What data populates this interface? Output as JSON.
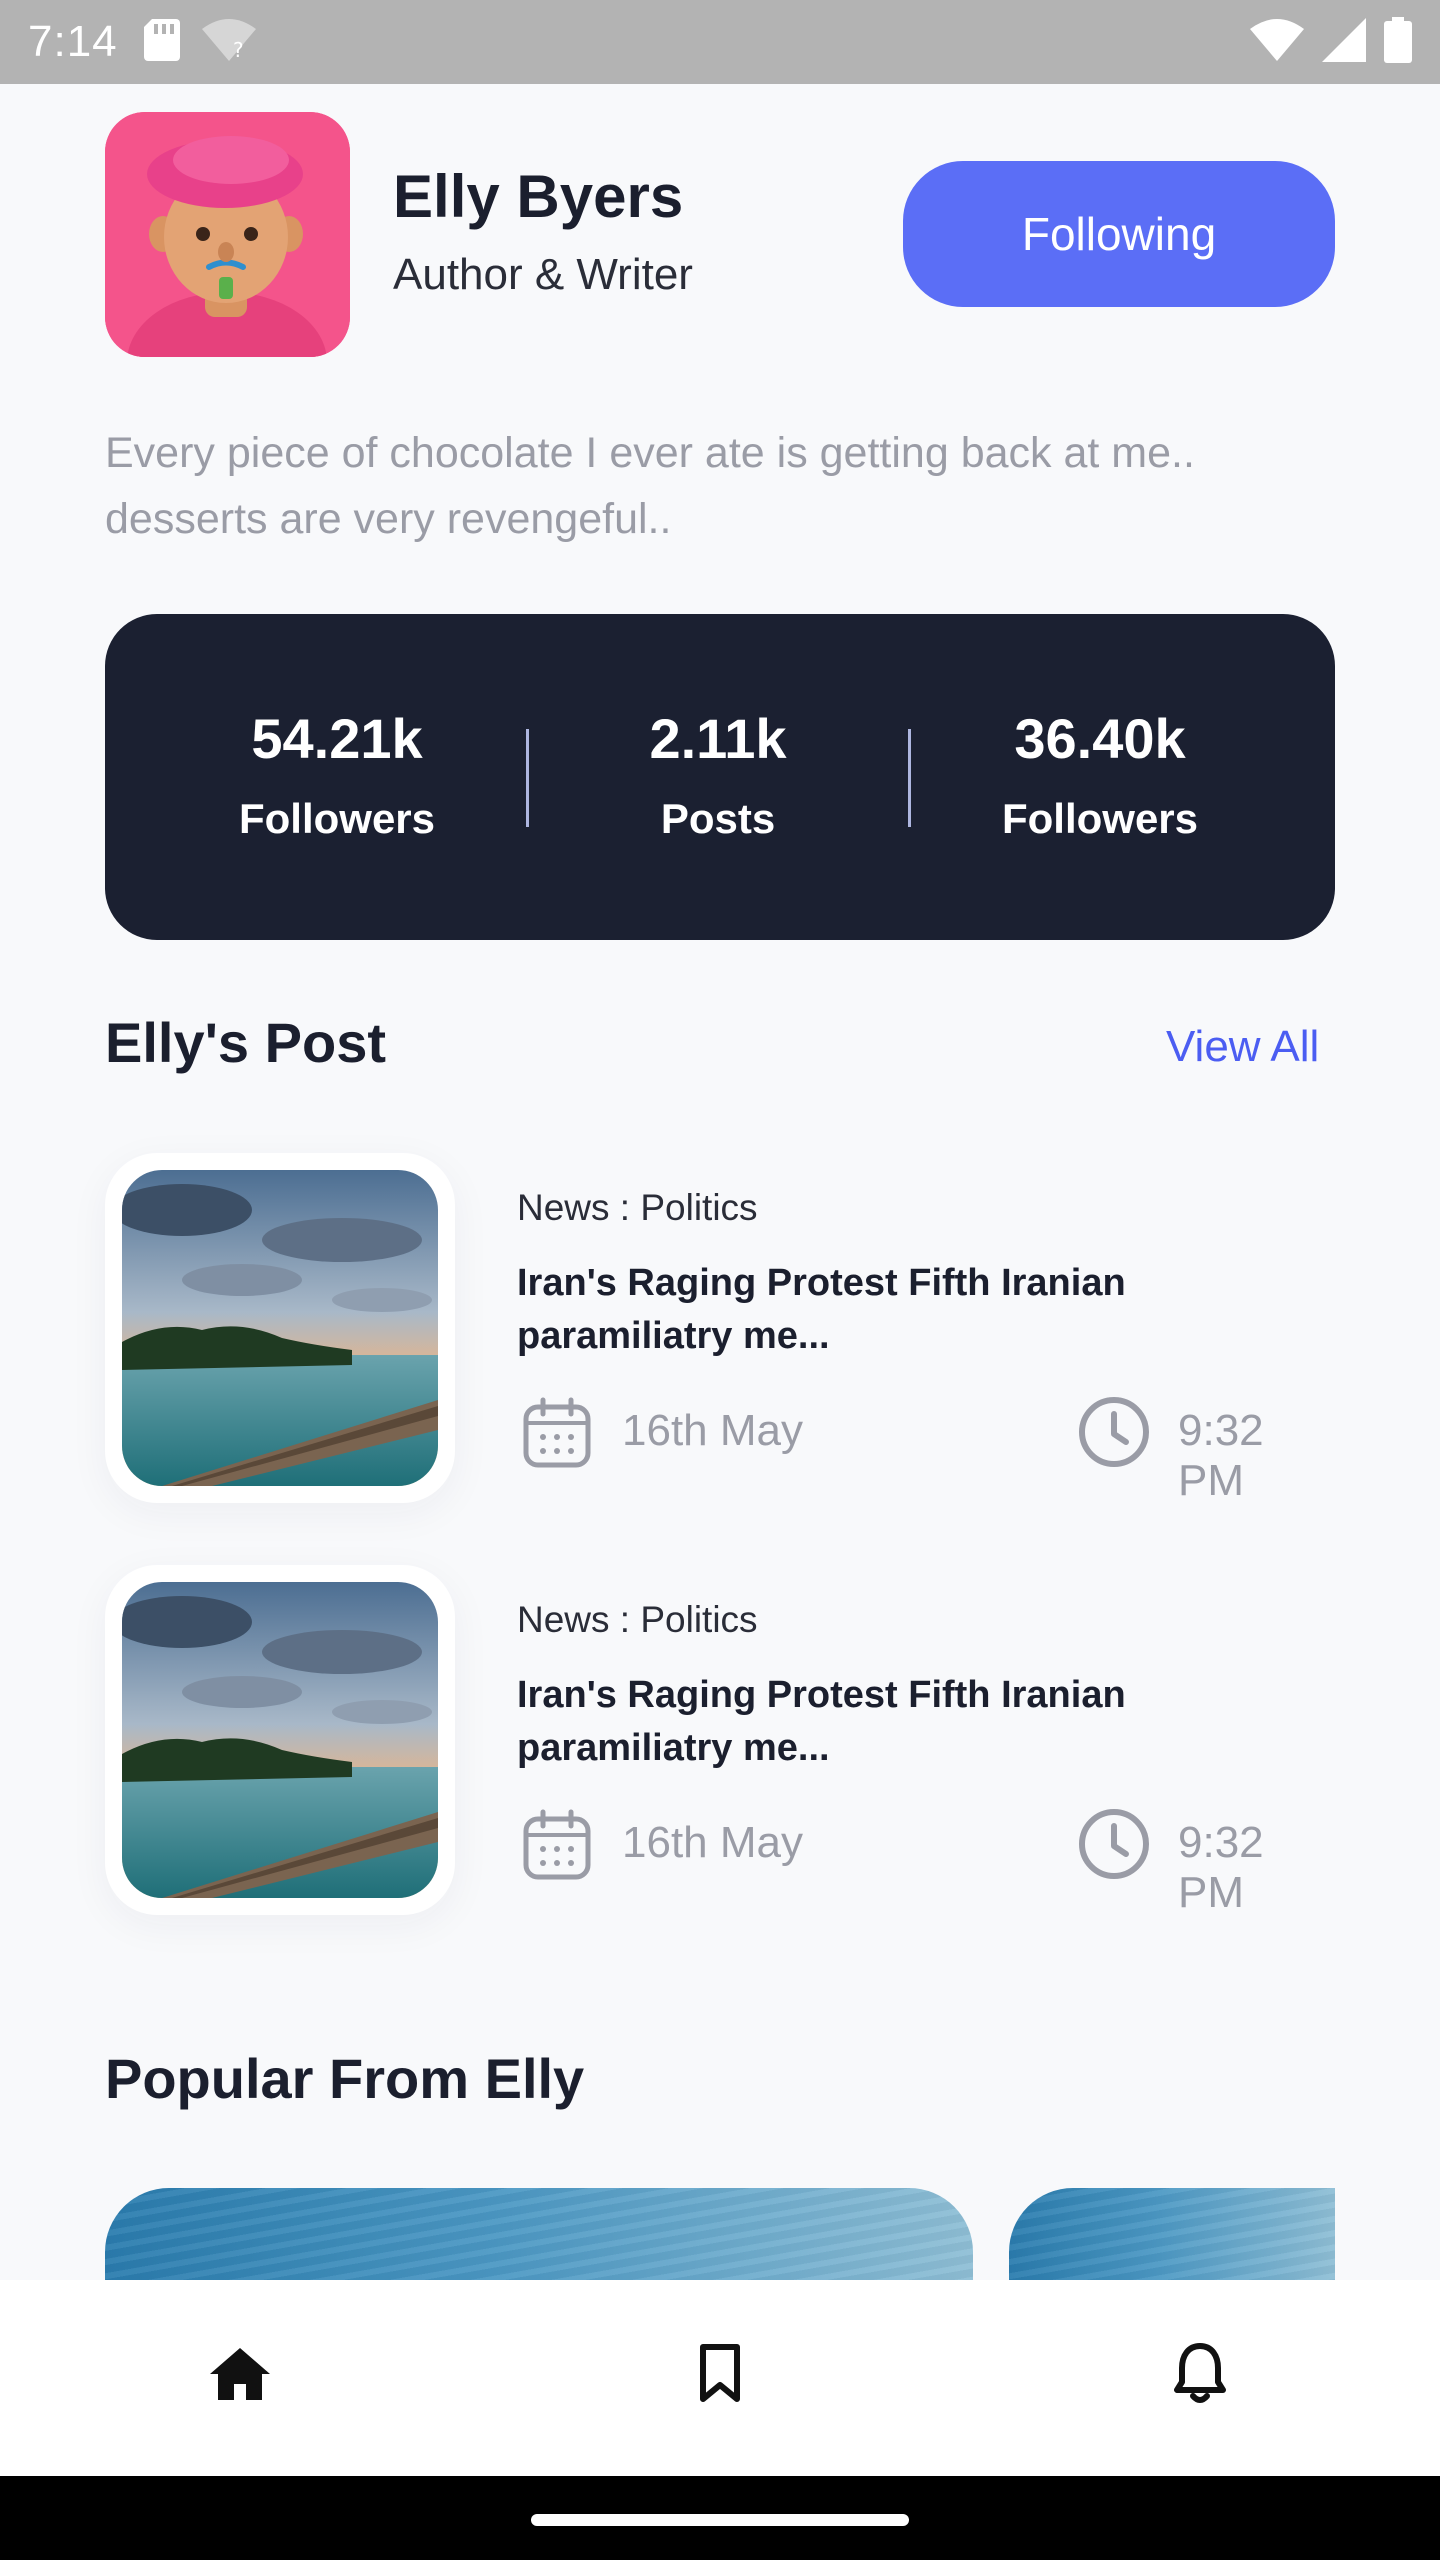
{
  "status_bar": {
    "time": "7:14"
  },
  "profile": {
    "name": "Elly Byers",
    "role": "Author & Writer",
    "follow_button": "Following",
    "bio": "Every piece of chocolate I ever ate is getting back at me.. desserts are very revengeful.."
  },
  "stats": [
    {
      "value": "54.21k",
      "label": "Followers"
    },
    {
      "value": "2.11k",
      "label": "Posts"
    },
    {
      "value": "36.40k",
      "label": "Followers"
    }
  ],
  "posts_section": {
    "title": "Elly's Post",
    "view_all": "View All"
  },
  "posts": [
    {
      "category": "News : Politics",
      "title": "Iran's Raging Protest Fifth Iranian paramiliatry me...",
      "date": "16th May",
      "time": "9:32 PM"
    },
    {
      "category": "News : Politics",
      "title": "Iran's Raging Protest Fifth Iranian paramiliatry me...",
      "date": "16th May",
      "time": "9:32 PM"
    }
  ],
  "popular_section": {
    "title": "Popular From Elly"
  },
  "bottom_nav": [
    {
      "name": "home",
      "icon": "home-icon"
    },
    {
      "name": "bookmarks",
      "icon": "bookmark-icon"
    },
    {
      "name": "notifications",
      "icon": "bell-icon"
    }
  ],
  "colors": {
    "accent": "#5b6ef6",
    "stats_background": "#1b2031",
    "avatar_background": "#f4548b",
    "muted_text": "#9a9ca6"
  }
}
